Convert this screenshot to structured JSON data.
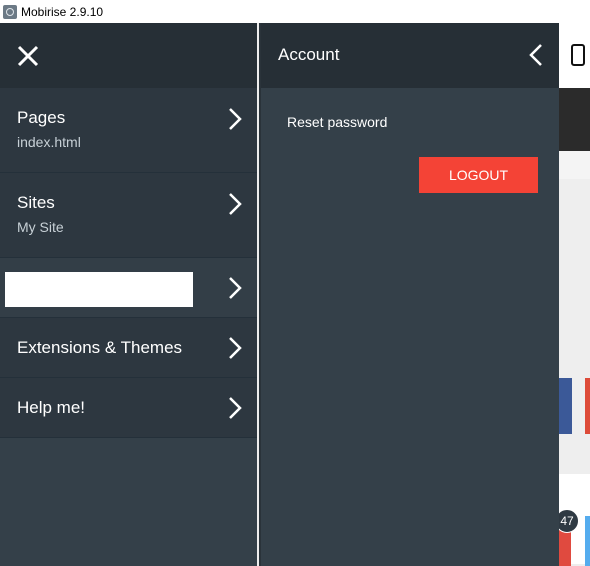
{
  "window": {
    "title": "Mobirise 2.9.10"
  },
  "menu": {
    "items": [
      {
        "label": "Pages",
        "sub": "index.html"
      },
      {
        "label": "Sites",
        "sub": "My Site"
      },
      {
        "label": "",
        "sub": ""
      },
      {
        "label": "Extensions & Themes"
      },
      {
        "label": "Help me!"
      }
    ]
  },
  "account": {
    "title": "Account",
    "reset_label": "Reset password",
    "logout_label": "LOGOUT"
  },
  "preview": {
    "badge_count": "47"
  },
  "icons": {
    "close": "close-icon",
    "chevron_right": "chevron-right-icon",
    "chevron_left": "chevron-left-icon",
    "mobile": "mobile-phone-icon"
  },
  "colors": {
    "panel": "#344049",
    "header": "#262f36",
    "logout": "#f44336"
  }
}
